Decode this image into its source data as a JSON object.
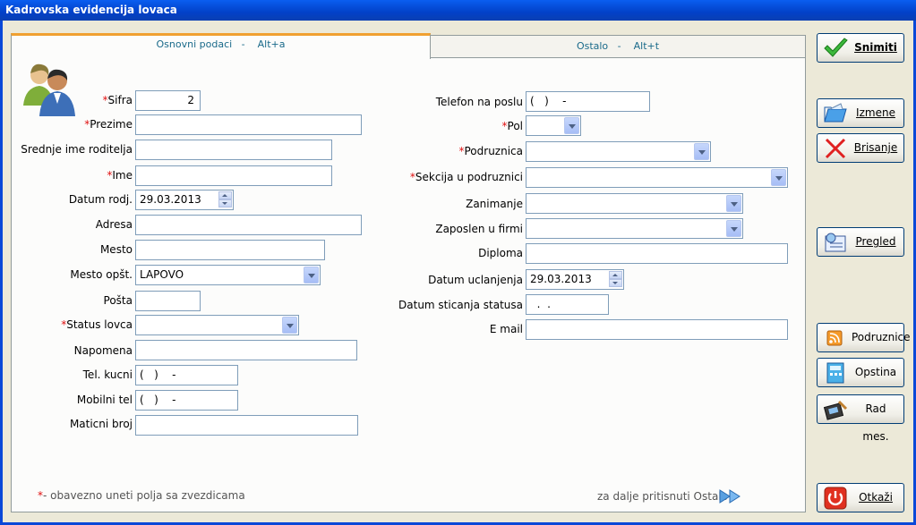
{
  "window": {
    "title": "Kadrovska evidencija lovaca"
  },
  "tabs": {
    "basic": "Osnovni podaci   -    Alt+a",
    "other": "Ostalo   -    Alt+t"
  },
  "left": {
    "sifra": {
      "label": "Sifra",
      "value": "2"
    },
    "prezime": {
      "label": "Prezime",
      "value": ""
    },
    "srednje_ime": {
      "label": "Srednje ime roditelja",
      "value": ""
    },
    "ime": {
      "label": "Ime",
      "value": ""
    },
    "datum_rodj": {
      "label": "Datum rodj.",
      "value": "29.03.2013"
    },
    "adresa": {
      "label": "Adresa",
      "value": ""
    },
    "mesto": {
      "label": "Mesto",
      "value": ""
    },
    "mesto_opst": {
      "label": "Mesto opšt.",
      "value": "LAPOVO"
    },
    "posta": {
      "label": "Pošta",
      "value": ""
    },
    "status_lovca": {
      "label": "Status lovca",
      "value": ""
    },
    "napomena": {
      "label": "Napomena",
      "value": ""
    },
    "tel_kucni": {
      "label": "Tel. kucni",
      "value": "(   )    -"
    },
    "mobilni_tel": {
      "label": "Mobilni tel",
      "value": "(   )    -"
    },
    "maticni_broj": {
      "label": "Maticni broj",
      "value": ""
    }
  },
  "right": {
    "telefon_posao": {
      "label": "Telefon na poslu",
      "value": "(   )    -"
    },
    "pol": {
      "label": "Pol",
      "value": ""
    },
    "podruznica": {
      "label": "Podruznica",
      "value": ""
    },
    "sekcija": {
      "label": "Sekcija u podruznici",
      "value": ""
    },
    "zanimanje": {
      "label": "Zanimanje",
      "value": ""
    },
    "zaposlen": {
      "label": "Zaposlen u firmi",
      "value": ""
    },
    "diploma": {
      "label": "Diploma",
      "value": ""
    },
    "datum_uclanjenja": {
      "label": "Datum uclanjenja",
      "value": "29.03.2013"
    },
    "datum_sticanja": {
      "label": "Datum sticanja statusa",
      "value": "  .  ."
    },
    "email": {
      "label": "E mail",
      "value": ""
    }
  },
  "required_mark": "*",
  "footer": {
    "required_note": "- obavezno uneti polja sa zvezdicama",
    "next_hint": "za dalje pritisnuti Ostalo"
  },
  "buttons": {
    "snimiti": "Snimiti",
    "izmene": "Izmene",
    "brisanje": "Brisanje",
    "pregled": "Pregled",
    "podruznice": "Podruznice",
    "opstina": "Opstina",
    "rad_mes": "Rad mes.",
    "otkazi": "Otkaži"
  },
  "colors": {
    "title_bar": "#0241c8",
    "required": "#e01010",
    "tab_text": "#1a6a8a"
  }
}
